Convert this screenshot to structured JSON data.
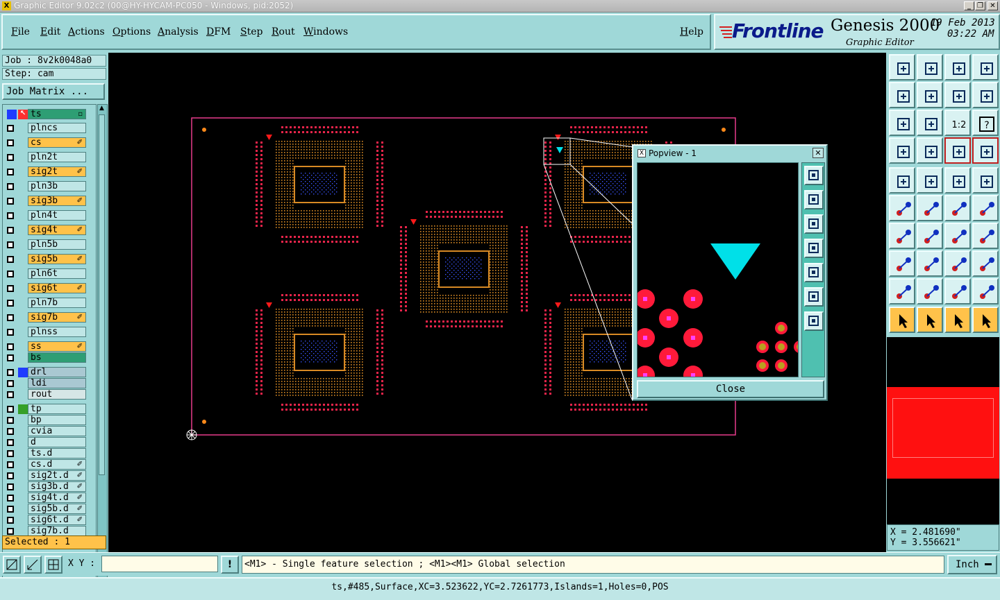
{
  "window": {
    "title": "Graphic Editor 9.02c2 (00@HY-HYCAM-PC050 - Windows, pid:2052)",
    "app_icon": "X"
  },
  "menubar": {
    "items": [
      "File",
      "Edit",
      "Actions",
      "Options",
      "Analysis",
      "DFM",
      "Step",
      "Rout",
      "Windows"
    ],
    "help": "Help"
  },
  "brand": {
    "logo": "Frontline",
    "product": "Genesis 2000",
    "subtitle": "Graphic Editor",
    "date": "19 Feb 2013",
    "time": "03:22 AM"
  },
  "left_panel": {
    "job": "Job : 8v2k0048a0",
    "step": "Step: cam",
    "job_matrix_button": "Job Matrix ...",
    "selected": "Selected : 1",
    "layers": [
      {
        "name": "ts",
        "color": "#2e9e74",
        "swatch": "#1f3cff",
        "active": true,
        "flag": "▫"
      },
      {
        "name": "plncs",
        "color": "#bfe6e6"
      },
      {
        "name": "cs",
        "color": "#ffc24a",
        "flag": "✐"
      },
      {
        "name": "pln2t",
        "color": "#bfe6e6"
      },
      {
        "name": "sig2t",
        "color": "#ffc24a",
        "flag": "✐"
      },
      {
        "name": "pln3b",
        "color": "#bfe6e6"
      },
      {
        "name": "sig3b",
        "color": "#ffc24a",
        "flag": "✐"
      },
      {
        "name": "pln4t",
        "color": "#bfe6e6"
      },
      {
        "name": "sig4t",
        "color": "#ffc24a",
        "flag": "✐"
      },
      {
        "name": "pln5b",
        "color": "#bfe6e6"
      },
      {
        "name": "sig5b",
        "color": "#ffc24a",
        "flag": "✐"
      },
      {
        "name": "pln6t",
        "color": "#bfe6e6"
      },
      {
        "name": "sig6t",
        "color": "#ffc24a",
        "flag": "✐"
      },
      {
        "name": "pln7b",
        "color": "#bfe6e6"
      },
      {
        "name": "sig7b",
        "color": "#ffc24a",
        "flag": "✐"
      },
      {
        "name": "plnss",
        "color": "#bfe6e6"
      },
      {
        "name": "ss",
        "color": "#ffc24a",
        "flag": "✐"
      },
      {
        "name": "bs",
        "color": "#2e9e74"
      },
      {
        "name": "drl",
        "color": "#a9c8d2",
        "swatch": "#1f3cff"
      },
      {
        "name": "ldi",
        "color": "#a9c8d2"
      },
      {
        "name": "rout",
        "color": "#d6e6e6"
      },
      {
        "name": "tp",
        "color": "#bfe6e6",
        "swatch": "#35a028"
      },
      {
        "name": "bp",
        "color": "#bfe6e6"
      },
      {
        "name": "cvia",
        "color": "#bfe6e6"
      },
      {
        "name": "d",
        "color": "#bfe6e6"
      },
      {
        "name": "ts.d",
        "color": "#bfe6e6"
      },
      {
        "name": "cs.d",
        "color": "#bfe6e6",
        "flag": "✐"
      },
      {
        "name": "sig2t.d",
        "color": "#bfe6e6",
        "flag": "✐"
      },
      {
        "name": "sig3b.d",
        "color": "#bfe6e6",
        "flag": "✐"
      },
      {
        "name": "sig4t.d",
        "color": "#bfe6e6",
        "flag": "✐"
      },
      {
        "name": "sig5b.d",
        "color": "#bfe6e6",
        "flag": "✐"
      },
      {
        "name": "sig6t.d",
        "color": "#bfe6e6",
        "flag": "✐"
      },
      {
        "name": "sig7b.d",
        "color": "#bfe6e6"
      }
    ]
  },
  "popview": {
    "title": "Popview - 1",
    "close_label": "Close",
    "close_x": "✕"
  },
  "right_panel": {
    "coord_x": "X = 2.481690\"",
    "coord_y": "Y = 3.556621\"",
    "tools_ratio_label": "1:2",
    "tools_help_label": "?"
  },
  "bottom": {
    "xy_label": "X Y :",
    "xy_value": "",
    "bang": "!",
    "prompt": "<M1> - Single feature selection ; <M1><M1> Global selection",
    "units": "Inch",
    "status": "ts,#485,Surface,XC=3.523622,YC=2.7261773,Islands=1,Holes=0,POS"
  },
  "colors": {
    "panel": "#9fd8d8",
    "pad_red": "#e8244a",
    "pad_orange": "#d88a24",
    "pad_blue": "#3a56ff",
    "outline": "#e83c8c",
    "marker_cyan": "#00e0e8"
  }
}
